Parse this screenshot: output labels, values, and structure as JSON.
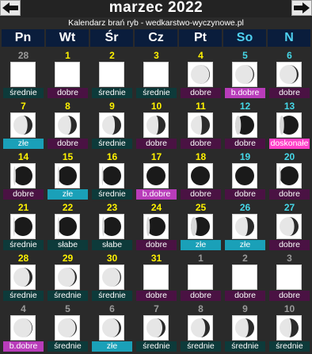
{
  "header": {
    "title": "marzec 2022",
    "subtitle": "Kalendarz brań ryb - wedkarstwo-wyczynowe.pl"
  },
  "nav": {
    "prev_icon": "arrow-left-icon",
    "next_icon": "arrow-right-icon"
  },
  "days": [
    "Pn",
    "Wt",
    "Śr",
    "Cz",
    "Pt",
    "So",
    "N"
  ],
  "weekend_color": "#45d8e8",
  "weeks": [
    [
      {
        "n": "28",
        "ghost": true,
        "q": "średnie",
        "qc": "srednie",
        "ph": 0.0
      },
      {
        "n": "1",
        "q": "dobre",
        "qc": "dobre",
        "ph": 0.0
      },
      {
        "n": "2",
        "q": "średnie",
        "qc": "srednie",
        "ph": 0.0
      },
      {
        "n": "3",
        "q": "średnie",
        "qc": "srednie",
        "ph": 0.0
      },
      {
        "n": "4",
        "q": "dobre",
        "qc": "dobre",
        "ph": 0.04
      },
      {
        "n": "5",
        "q": "b.dobre",
        "qc": "bdobre",
        "ph": 0.07
      },
      {
        "n": "6",
        "q": "dobre",
        "qc": "dobre",
        "ph": 0.12
      }
    ],
    [
      {
        "n": "7",
        "q": "złe",
        "qc": "zle",
        "ph": 0.35
      },
      {
        "n": "8",
        "q": "dobre",
        "qc": "dobre",
        "ph": 0.4
      },
      {
        "n": "9",
        "q": "średnie",
        "qc": "srednie",
        "ph": 0.44
      },
      {
        "n": "10",
        "q": "dobre",
        "qc": "dobre",
        "ph": 0.5
      },
      {
        "n": "11",
        "q": "dobre",
        "qc": "dobre",
        "ph": 0.56
      },
      {
        "n": "12",
        "q": "dobre",
        "qc": "dobre",
        "ph": 0.62
      },
      {
        "n": "13",
        "q": "doskonałe",
        "qc": "doskonale",
        "ph": 0.7
      }
    ],
    [
      {
        "n": "14",
        "q": "dobre",
        "qc": "dobre",
        "ph": 0.85
      },
      {
        "n": "15",
        "q": "złe",
        "qc": "zle",
        "ph": 0.9
      },
      {
        "n": "16",
        "q": "średnie",
        "qc": "srednie",
        "ph": 0.95
      },
      {
        "n": "17",
        "q": "b.dobre",
        "qc": "bdobre",
        "ph": 1.0
      },
      {
        "n": "18",
        "q": "dobre",
        "qc": "dobre",
        "ph": 1.0
      },
      {
        "n": "19",
        "q": "dobre",
        "qc": "dobre",
        "ph": 1.0
      },
      {
        "n": "20",
        "q": "dobre",
        "qc": "dobre",
        "ph": 0.95
      }
    ],
    [
      {
        "n": "21",
        "q": "średnie",
        "qc": "srednie",
        "ph": 0.92
      },
      {
        "n": "22",
        "q": "słabe",
        "qc": "slabe",
        "ph": 0.9
      },
      {
        "n": "23",
        "q": "słabe",
        "qc": "slabe",
        "ph": 0.85
      },
      {
        "n": "24",
        "q": "dobre",
        "qc": "dobre",
        "ph": 0.78
      },
      {
        "n": "25",
        "q": "złe",
        "qc": "zle",
        "ph": 0.6
      },
      {
        "n": "26",
        "q": "złe",
        "qc": "zle",
        "ph": 0.45
      },
      {
        "n": "27",
        "q": "dobre",
        "qc": "dobre",
        "ph": 0.3
      }
    ],
    [
      {
        "n": "28",
        "q": "średnie",
        "qc": "srednie",
        "ph": 0.2
      },
      {
        "n": "29",
        "q": "średnie",
        "qc": "srednie",
        "ph": 0.12
      },
      {
        "n": "30",
        "q": "średnie",
        "qc": "srednie",
        "ph": 0.07
      },
      {
        "n": "31",
        "q": "dobre",
        "qc": "dobre",
        "ph": 0.0
      },
      {
        "n": "1",
        "ghost": true,
        "q": "dobre",
        "qc": "dobre",
        "ph": 0.0
      },
      {
        "n": "2",
        "ghost": true,
        "q": "dobre",
        "qc": "dobre",
        "ph": 0.0
      },
      {
        "n": "3",
        "ghost": true,
        "q": "dobre",
        "qc": "dobre",
        "ph": 0.0
      }
    ],
    [
      {
        "n": "4",
        "ghost": true,
        "q": "b.dobre",
        "qc": "bdobre",
        "ph": 0.04
      },
      {
        "n": "5",
        "ghost": true,
        "q": "średnie",
        "qc": "srednie",
        "ph": 0.08
      },
      {
        "n": "6",
        "ghost": true,
        "q": "złe",
        "qc": "zle",
        "ph": 0.14
      },
      {
        "n": "7",
        "ghost": true,
        "q": "średnie",
        "qc": "srednie",
        "ph": 0.22
      },
      {
        "n": "8",
        "ghost": true,
        "q": "średnie",
        "qc": "srednie",
        "ph": 0.32
      },
      {
        "n": "9",
        "ghost": true,
        "q": "średnie",
        "qc": "srednie",
        "ph": 0.4
      },
      {
        "n": "10",
        "ghost": true,
        "q": "średnie",
        "qc": "srednie",
        "ph": 0.5
      }
    ]
  ]
}
